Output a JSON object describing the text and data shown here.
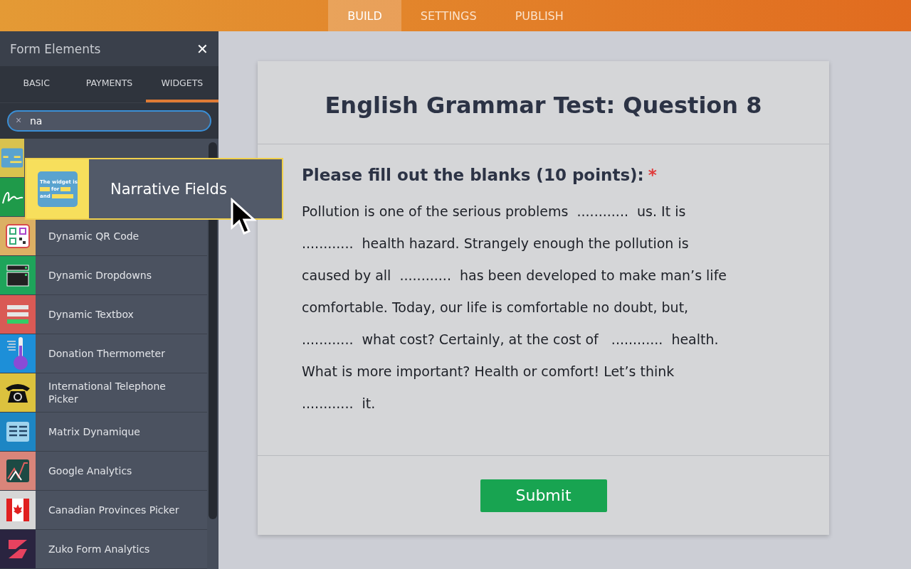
{
  "top_tabs": [
    {
      "label": "BUILD",
      "selected": true
    },
    {
      "label": "SETTINGS",
      "selected": false
    },
    {
      "label": "PUBLISH",
      "selected": false
    }
  ],
  "sidebar": {
    "title": "Form Elements",
    "close": "✕",
    "tabs": [
      {
        "label": "BASIC",
        "selected": false
      },
      {
        "label": "PAYMENTS",
        "selected": false
      },
      {
        "label": "WIDGETS",
        "selected": true
      }
    ],
    "search": {
      "value": "na",
      "clear": "×"
    },
    "items": [
      {
        "kind": "narrative",
        "color": "#d9c24e"
      },
      {
        "kind": "signature",
        "color": "#1f9a4a"
      },
      {
        "kind": "qr",
        "label": "Dynamic QR Code",
        "color": "#dcb064"
      },
      {
        "kind": "dropdowns",
        "label": "Dynamic Dropdowns",
        "color": "#1ea45a"
      },
      {
        "kind": "textbox",
        "label": "Dynamic Textbox",
        "color": "#d95a55"
      },
      {
        "kind": "thermometer",
        "label": "Donation Thermometer",
        "color": "#1d8fd8"
      },
      {
        "kind": "telephone",
        "label": "International Telephone Picker",
        "color": "#dcc23e"
      },
      {
        "kind": "matrix",
        "label": "Matrix Dynamique",
        "color": "#1d86c4"
      },
      {
        "kind": "analytics",
        "label": "Google Analytics",
        "color": "#d9857a"
      },
      {
        "kind": "flag",
        "label": "Canadian Provinces Picker",
        "color": "#d6d6d6"
      },
      {
        "kind": "zuko",
        "label": "Zuko Form Analytics",
        "color": "#2a2440"
      }
    ]
  },
  "dragged": {
    "label": "Narrative Fields",
    "icon_lines": [
      "The widget is",
      "for",
      "and"
    ]
  },
  "form": {
    "title": "English Grammar Test: Question 8",
    "question": "Please fill out the blanks (10 points):",
    "required": true,
    "required_mark": "*",
    "passage": [
      "Pollution is one of the serious problems  ............  us. It is",
      "............  health hazard. Strangely enough the pollution is",
      "caused by all  ............  has been developed to make man’s life",
      "comfortable. Today, our life is comfortable no doubt, but,",
      "............  what cost? Certainly, at the cost of   ............  health.",
      "What is more important? Health or comfort! Let’s think",
      "............  it."
    ],
    "submit": "Submit"
  }
}
